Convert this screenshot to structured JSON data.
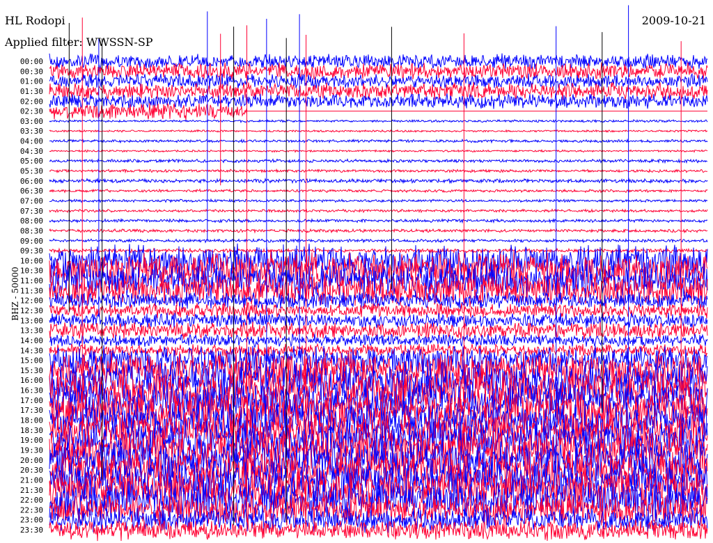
{
  "header": {
    "station": "HL Rodopi",
    "date": "2009-10-21",
    "filter_label": "Applied filter: WWSSN-SP"
  },
  "chart_data": {
    "type": "line",
    "title": "HL Rodopi",
    "ylabel": "BHZ - 50000",
    "colors": [
      "#0000ff",
      "#ff0033"
    ],
    "row_labels": [
      "00:00",
      "00:30",
      "01:00",
      "01:30",
      "02:00",
      "02:30",
      "03:00",
      "03:30",
      "04:00",
      "04:30",
      "05:00",
      "05:30",
      "06:00",
      "06:30",
      "07:00",
      "07:30",
      "08:00",
      "08:30",
      "09:00",
      "09:30",
      "10:00",
      "10:30",
      "11:00",
      "11:30",
      "12:00",
      "12:30",
      "13:00",
      "13:30",
      "14:00",
      "14:30",
      "15:00",
      "15:30",
      "16:00",
      "16:30",
      "17:00",
      "17:30",
      "18:00",
      "18:30",
      "19:00",
      "19:30",
      "20:00",
      "20:30",
      "21:00",
      "21:30",
      "22:00",
      "22:30",
      "23:00",
      "23:30"
    ],
    "relative_amplitude": [
      0.35,
      0.4,
      0.35,
      0.4,
      0.35,
      0.4,
      0.04,
      0.03,
      0.05,
      0.03,
      0.06,
      0.05,
      0.08,
      0.05,
      0.05,
      0.05,
      0.06,
      0.06,
      0.06,
      0.08,
      0.8,
      0.9,
      0.9,
      0.8,
      0.4,
      0.35,
      0.35,
      0.4,
      0.3,
      0.3,
      0.7,
      0.9,
      1.0,
      1.0,
      1.0,
      1.0,
      0.9,
      0.9,
      1.0,
      1.0,
      1.0,
      1.0,
      1.0,
      1.0,
      1.0,
      0.8,
      0.6,
      0.5
    ],
    "data_end_fraction_row_0230": 0.3,
    "spike_positions_fraction": [
      0.03,
      0.05,
      0.075,
      0.08,
      0.24,
      0.26,
      0.28,
      0.3,
      0.33,
      0.36,
      0.38,
      0.39,
      0.52,
      0.63,
      0.77,
      0.84,
      0.88,
      0.96
    ]
  }
}
